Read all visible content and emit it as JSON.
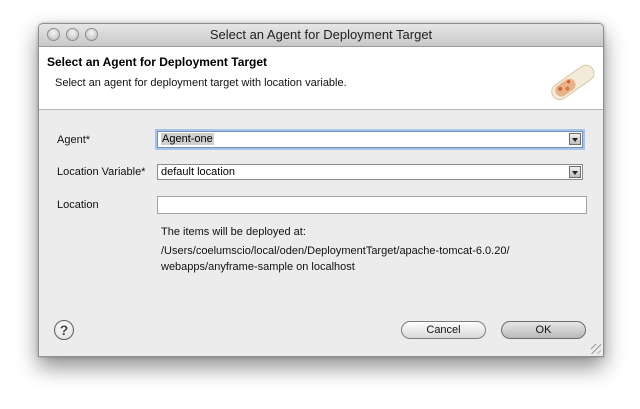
{
  "window": {
    "title": "Select an Agent for Deployment Target"
  },
  "banner": {
    "title": "Select an Agent for Deployment Target",
    "description": "Select an agent for deployment target with location variable."
  },
  "form": {
    "agent_label": "Agent*",
    "agent_value": "Agent-one",
    "location_variable_label": "Location Variable*",
    "location_variable_value": "default location",
    "location_label": "Location",
    "location_value": ""
  },
  "info": {
    "line1": "The items will be deployed at:",
    "line2": "/Users/coelumscio/local/oden/DeploymentTarget/apache-tomcat-6.0.20/",
    "line3": "webapps/anyframe-sample on localhost"
  },
  "buttons": {
    "help": "?",
    "cancel": "Cancel",
    "ok": "OK"
  }
}
